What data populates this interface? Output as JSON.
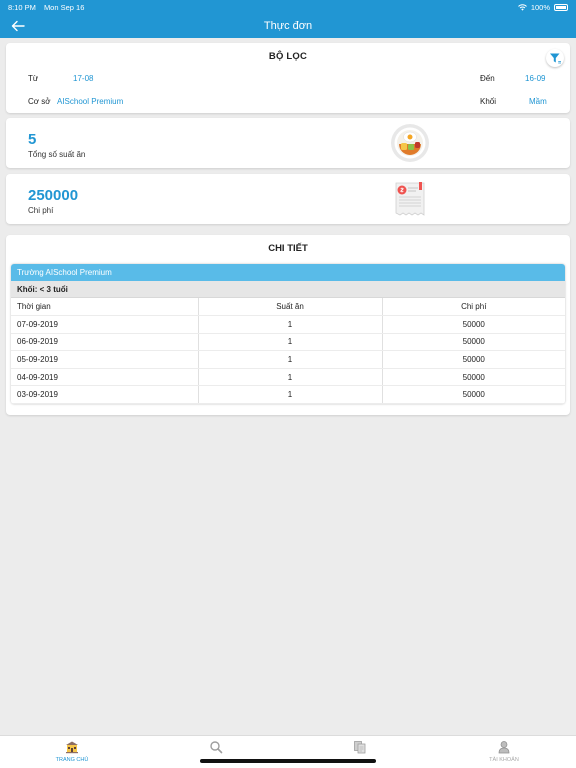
{
  "status": {
    "time": "8:10 PM",
    "date": "Mon Sep 16",
    "battery": "100%"
  },
  "header": {
    "title": "Thực đơn"
  },
  "filter": {
    "title": "BỘ LỌC",
    "from_label": "Từ",
    "from_value": "17-08",
    "to_label": "Đến",
    "to_value": "16-09",
    "facility_label": "Cơ sở",
    "facility_value": "AISchool Premium",
    "grade_label": "Khối",
    "grade_value": "Mầm"
  },
  "summary": {
    "meals_value": "5",
    "meals_label": "Tổng số suất ăn",
    "cost_value": "250000",
    "cost_label": "Chi phí"
  },
  "detail": {
    "title": "CHI TIẾT",
    "school": "Trường AISchool Premium",
    "grade": "Khối: < 3 tuổi",
    "columns": [
      "Thời gian",
      "Suất ăn",
      "Chi phí"
    ],
    "rows": [
      [
        "07-09-2019",
        "1",
        "50000"
      ],
      [
        "06-09-2019",
        "1",
        "50000"
      ],
      [
        "05-09-2019",
        "1",
        "50000"
      ],
      [
        "04-09-2019",
        "1",
        "50000"
      ],
      [
        "03-09-2019",
        "1",
        "50000"
      ]
    ]
  },
  "tabs": [
    {
      "label": "TRANG CHỦ",
      "icon": "school-icon"
    },
    {
      "label": "",
      "icon": "search-icon"
    },
    {
      "label": "",
      "icon": "documents-icon"
    },
    {
      "label": "TÀI KHOẢN",
      "icon": "account-icon"
    }
  ],
  "colors": {
    "primary": "#2196d3",
    "panel_header": "#59bbe8"
  }
}
